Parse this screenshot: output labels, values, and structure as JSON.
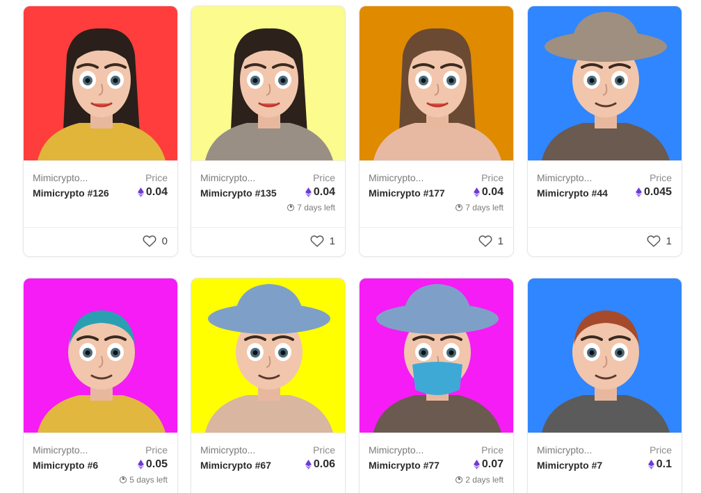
{
  "cards": [
    {
      "collection": "Mimicrypto...",
      "name": "Mimicrypto #126",
      "price_label": "Price",
      "price": "0.04",
      "time_left": "",
      "likes": "0",
      "bg": "#ff3d3d",
      "accent": "#e0b53a",
      "hair": "#2a1f1a"
    },
    {
      "collection": "Mimicrypto...",
      "name": "Mimicrypto #135",
      "price_label": "Price",
      "price": "0.04",
      "time_left": "7 days left",
      "likes": "1",
      "bg": "#fbfb8e",
      "accent": "#9a8f85",
      "hair": "#2c211b"
    },
    {
      "collection": "Mimicrypto...",
      "name": "Mimicrypto #177",
      "price_label": "Price",
      "price": "0.04",
      "time_left": "7 days left",
      "likes": "1",
      "bg": "#e08a00",
      "accent": "#e7b9a2",
      "hair": "#6b4a33"
    },
    {
      "collection": "Mimicrypto...",
      "name": "Mimicrypto #44",
      "price_label": "Price",
      "price": "0.045",
      "time_left": "",
      "likes": "1",
      "bg": "#2f86ff",
      "accent": "#6a5a50",
      "hair": "#9f8f80"
    },
    {
      "collection": "Mimicrypto...",
      "name": "Mimicrypto #6",
      "price_label": "Price",
      "price": "0.05",
      "time_left": "5 days left",
      "likes": "",
      "bg": "#f51cf5",
      "accent": "#e2b740",
      "hair": "#2a9fb2"
    },
    {
      "collection": "Mimicrypto...",
      "name": "Mimicrypto #67",
      "price_label": "Price",
      "price": "0.06",
      "time_left": "",
      "likes": "",
      "bg": "#ffff00",
      "accent": "#d8b6a0",
      "hair": "#7ea0c8"
    },
    {
      "collection": "Mimicrypto...",
      "name": "Mimicrypto #77",
      "price_label": "Price",
      "price": "0.07",
      "time_left": "2 days left",
      "likes": "",
      "bg": "#f51cf5",
      "accent": "#6a5a50",
      "hair": "#7ea0c8"
    },
    {
      "collection": "Mimicrypto...",
      "name": "Mimicrypto #7",
      "price_label": "Price",
      "price": "0.1",
      "time_left": "",
      "likes": "",
      "bg": "#2f86ff",
      "accent": "#5b5b5b",
      "hair": "#a54b2c"
    }
  ]
}
